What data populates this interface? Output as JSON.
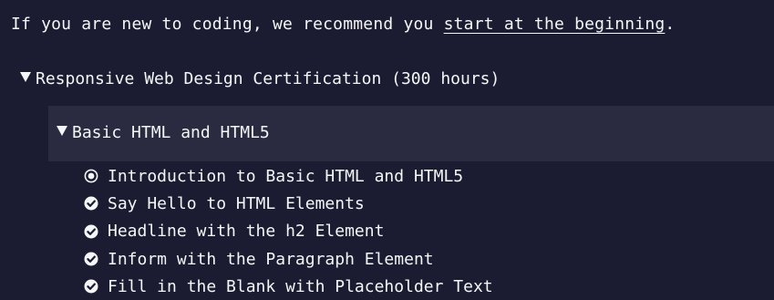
{
  "intro": {
    "prefix": "If you are new to coding, we recommend you ",
    "link_text": "start at the beginning",
    "suffix": "."
  },
  "certification": {
    "title": "Responsive Web Design Certification (300 hours)",
    "expanded": true
  },
  "block": {
    "title": "Basic HTML and HTML5",
    "expanded": true
  },
  "lessons": [
    {
      "title": "Introduction to Basic HTML and HTML5",
      "status": "current",
      "icon": "radio-current-icon"
    },
    {
      "title": "Say Hello to HTML Elements",
      "status": "completed",
      "icon": "check-circle-icon"
    },
    {
      "title": "Headline with the h2 Element",
      "status": "completed",
      "icon": "check-circle-icon"
    },
    {
      "title": "Inform with the Paragraph Element",
      "status": "completed",
      "icon": "check-circle-icon"
    },
    {
      "title": "Fill in the Blank with Placeholder Text",
      "status": "completed",
      "icon": "check-circle-icon"
    }
  ],
  "colors": {
    "background": "#1b1b32",
    "block_background": "#2a2a40",
    "text": "#f5f6f7"
  }
}
